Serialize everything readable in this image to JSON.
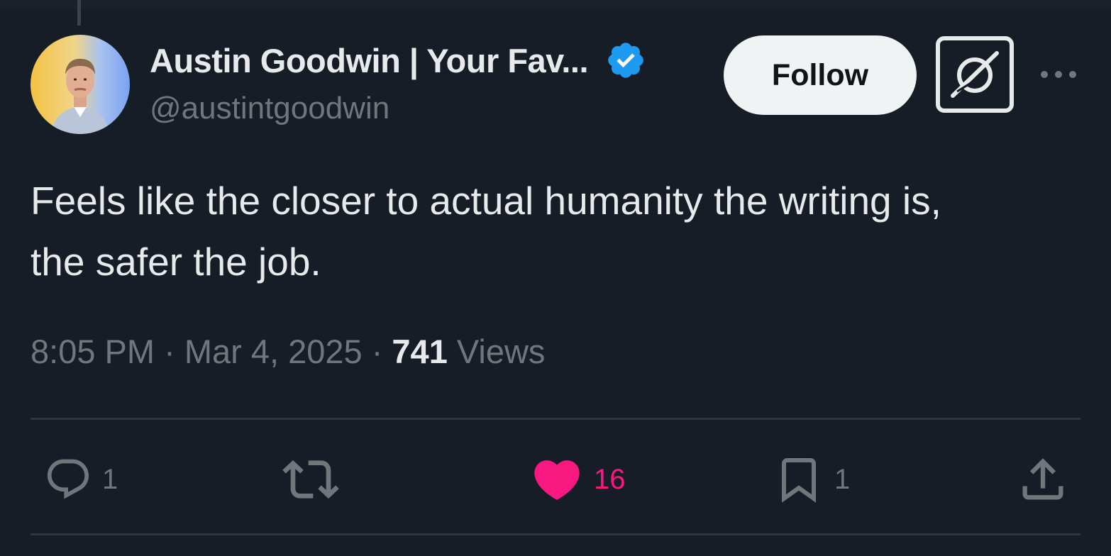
{
  "post": {
    "author": {
      "display_name": "Austin Goodwin | Your Fav...",
      "handle": "@austintgoodwin",
      "verified": true
    },
    "follow_label": "Follow",
    "text_line1": "Feels like the closer to actual humanity the writing is,",
    "text_line2": "the safer the job.",
    "time": "8:05 PM",
    "separator": "·",
    "date": "Mar 4, 2025",
    "views_count": "741",
    "views_label": "Views"
  },
  "actions": {
    "replies": "1",
    "reposts": "",
    "likes": "16",
    "bookmarks": "1"
  },
  "icons": [
    "verified-badge-icon",
    "grok-icon",
    "more-icon",
    "reply-icon",
    "repost-icon",
    "heart-icon",
    "bookmark-icon",
    "share-icon"
  ],
  "colors": {
    "background": "#161d27",
    "text": "#e7e9ea",
    "muted": "#71767b",
    "like": "#f91880",
    "verified": "#1d9bf0",
    "follow_bg": "#eff3f4"
  }
}
